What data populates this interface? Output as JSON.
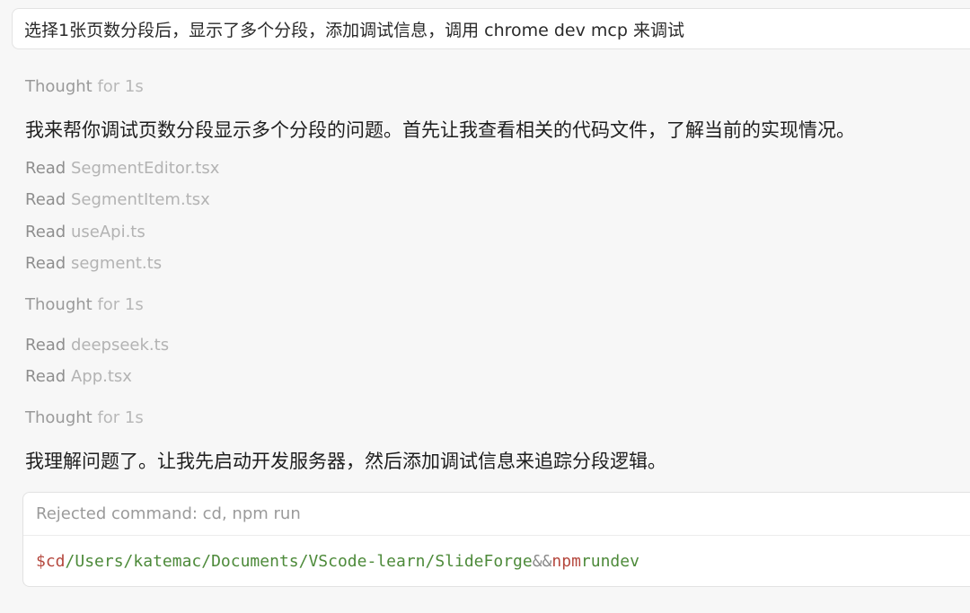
{
  "user_message": "选择1张页数分段后，显示了多个分段，添加调试信息，调用 chrome dev mcp 来调试",
  "thought_label": "Thought",
  "thought_duration": "for 1s",
  "read_label": "Read",
  "assistant": {
    "msg1": "我来帮你调试页数分段显示多个分段的问题。首先让我查看相关的代码文件，了解当前的实现情况。",
    "msg2": "我理解问题了。让我先启动开发服务器，然后添加调试信息来追踪分段逻辑。"
  },
  "reads": {
    "group1": [
      "SegmentEditor.tsx",
      "SegmentItem.tsx",
      "useApi.ts",
      "segment.ts"
    ],
    "group2": [
      "deepseek.ts",
      "App.tsx"
    ]
  },
  "command_card": {
    "header": "Rejected command: cd, npm run",
    "prompt": "$",
    "cmd1": "cd",
    "path": "/Users/katemac/Documents/VScode-learn/SlideForge",
    "op": "&&",
    "cmd2": "npm",
    "arg1": "run",
    "arg2": "dev"
  },
  "colors": {
    "background": "#f7f7f7",
    "command_red": "#b5483e",
    "command_green": "#4d8a3a"
  }
}
